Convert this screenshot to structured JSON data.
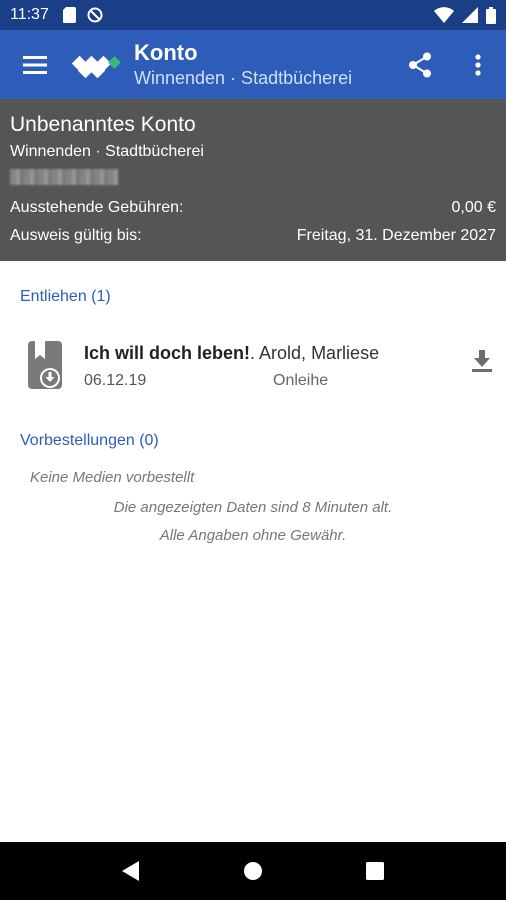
{
  "status_bar": {
    "time": "11:37",
    "left_icons": [
      "sd-card-icon",
      "do-not-disturb-icon"
    ],
    "right_icons": [
      "wifi-icon",
      "signal-icon",
      "battery-icon"
    ]
  },
  "app_bar": {
    "title": "Konto",
    "subtitle": "Winnenden · Stadtbücherei",
    "accent_color": "#2d5db8",
    "logo_accent": "#3cb878"
  },
  "account": {
    "name": "Unbenanntes Konto",
    "library": "Winnenden · Stadtbücherei",
    "fees_label": "Ausstehende Gebühren:",
    "fees_value": "0,00 €",
    "valid_label": "Ausweis gültig bis:",
    "valid_value": "Freitag, 31. Dezember 2027"
  },
  "lent": {
    "header": "Entliehen (1)",
    "items": [
      {
        "title": "Ich will doch leben!",
        "author": ". Arold, Marliese",
        "date": "06.12.19",
        "status": "Onleihe"
      }
    ]
  },
  "reservations": {
    "header": "Vorbestellungen (0)",
    "empty_text": "Keine Medien vorbestellt"
  },
  "footer": {
    "data_age": "Die angezeigten Daten sind 8 Minuten alt.",
    "disclaimer": "Alle Angaben ohne Gewähr."
  }
}
